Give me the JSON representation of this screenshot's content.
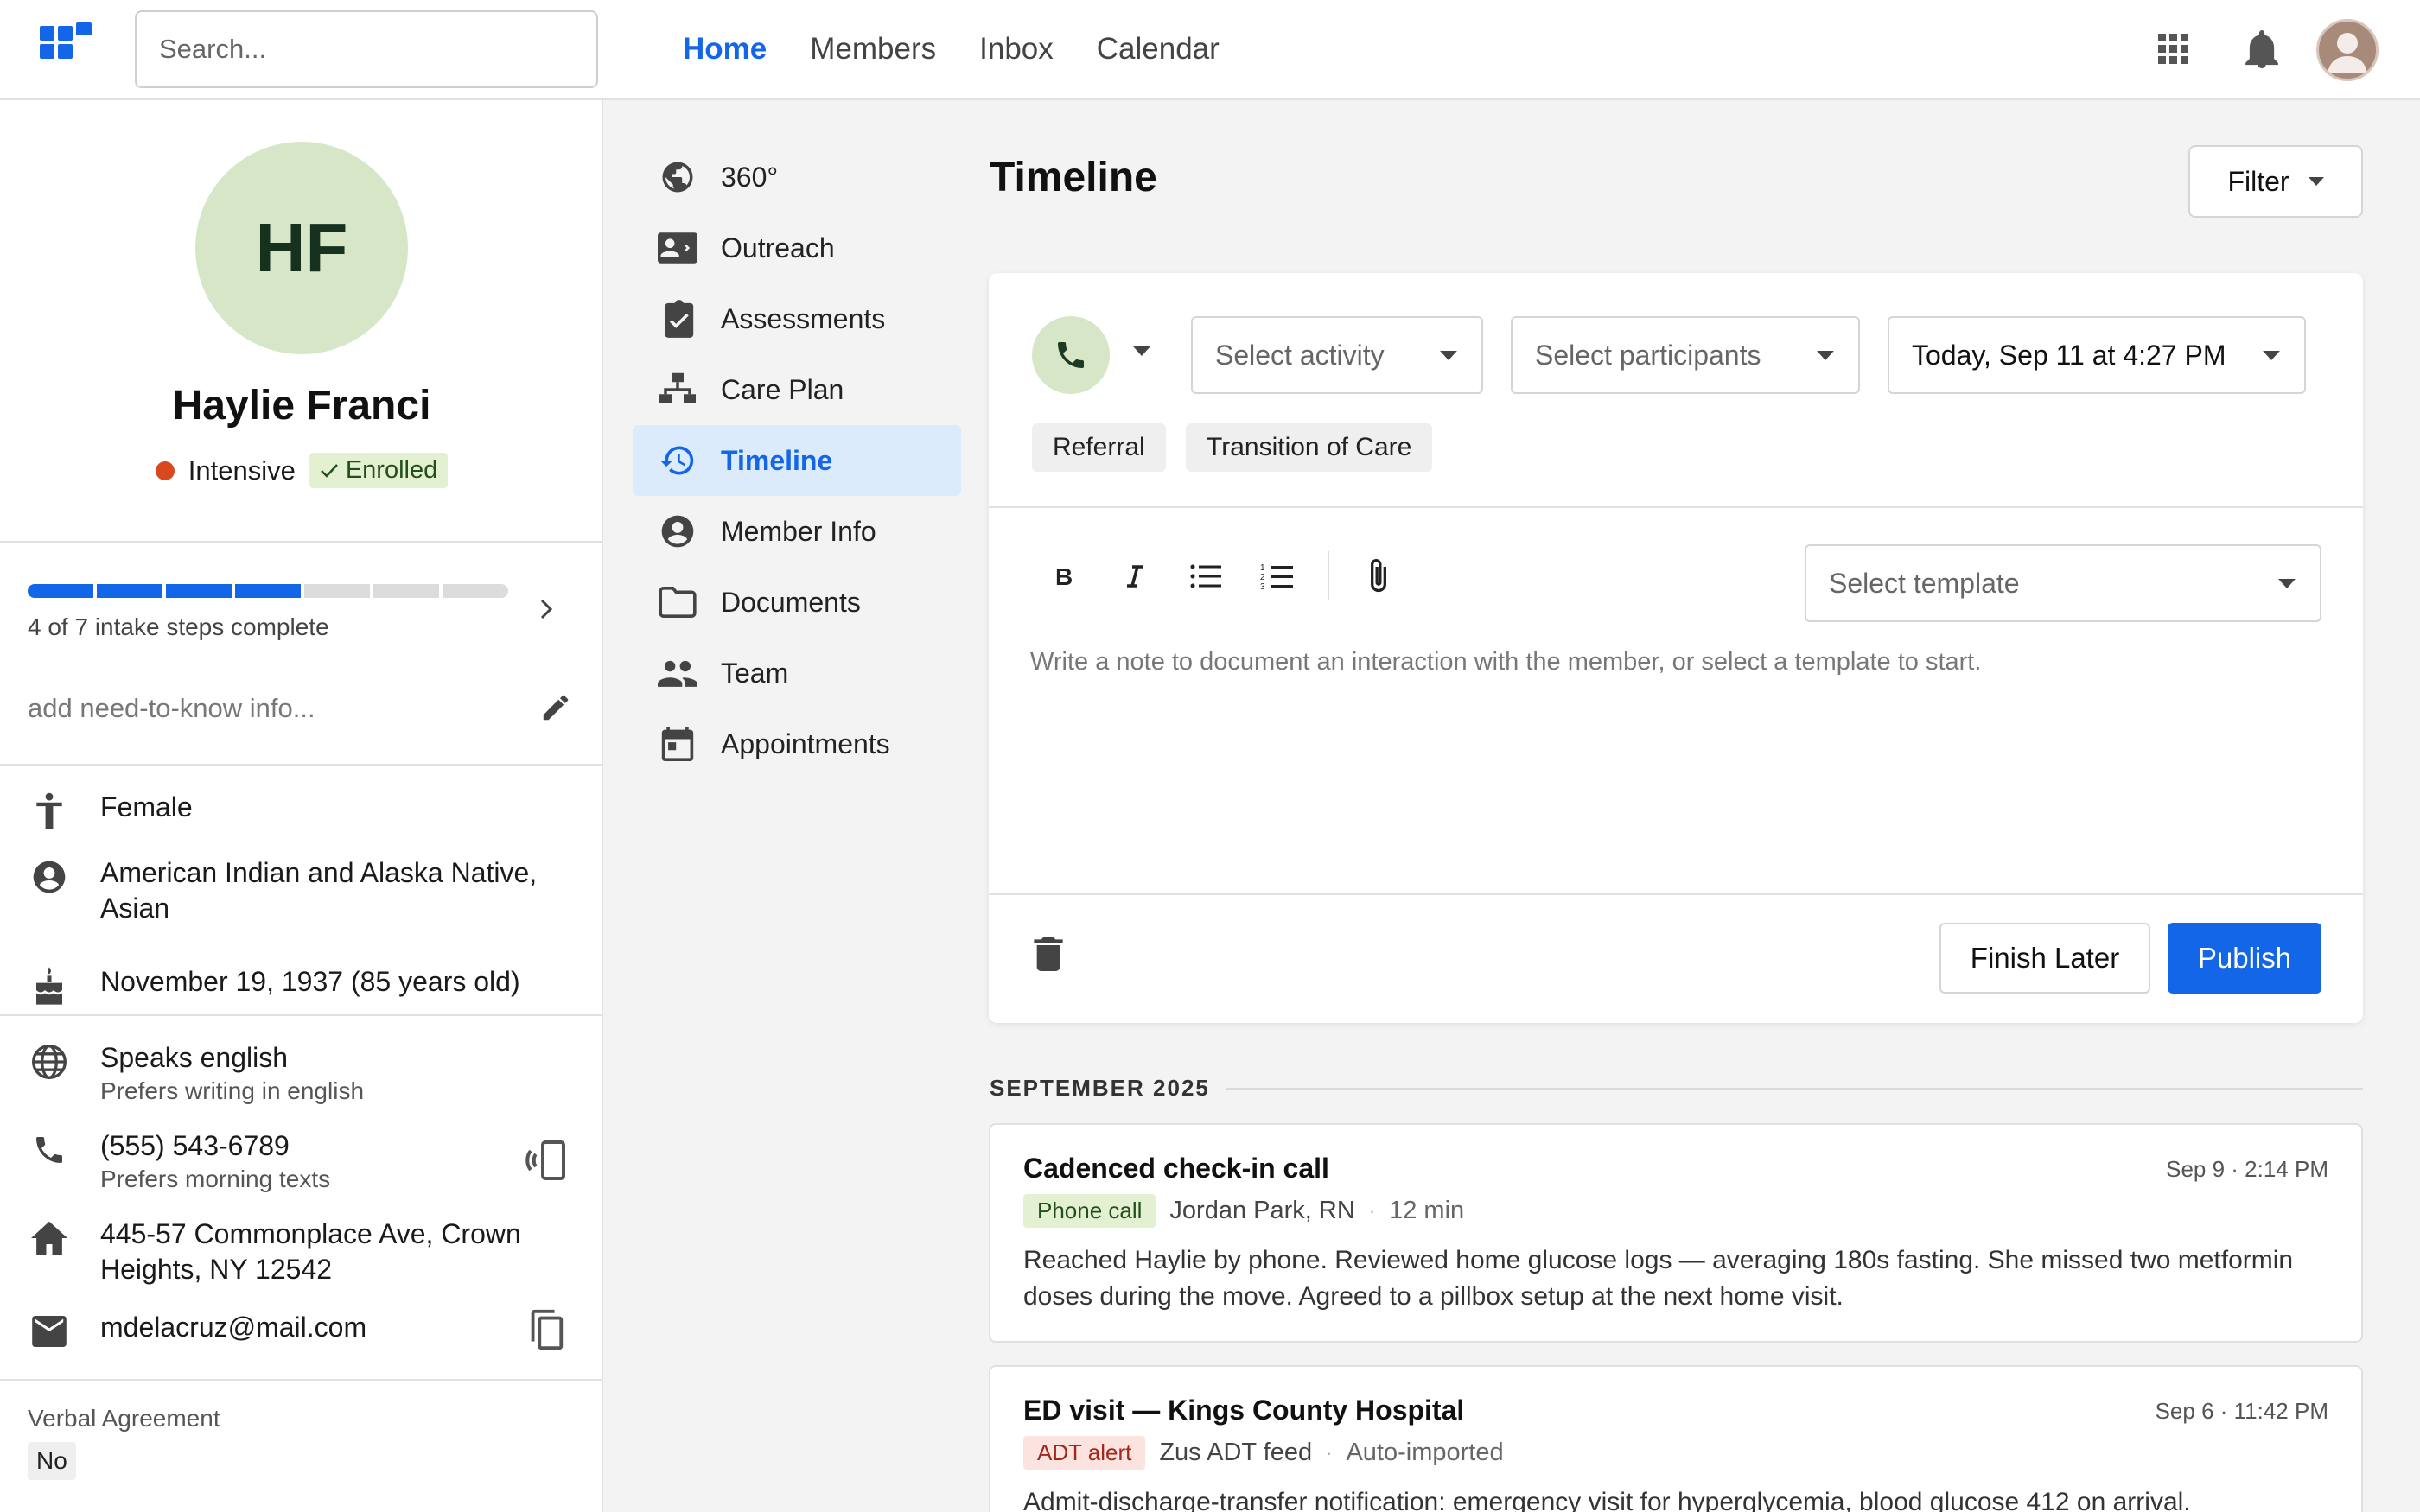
{
  "header": {
    "search_placeholder": "Search...",
    "nav": [
      "Home",
      "Members",
      "Inbox",
      "Calendar"
    ],
    "active_nav": "Home"
  },
  "member": {
    "initials": "HF",
    "name": "Haylie Franci",
    "acuity": "Intensive",
    "acuity_color": "#d9481f",
    "enrollment": "Enrolled",
    "intake_progress": {
      "completed": 4,
      "total": 7,
      "label": "4 of 7 intake steps complete"
    },
    "need_to_know_placeholder": "add need-to-know info...",
    "gender": "Female",
    "race_line1": "American Indian and Alaska Native,",
    "race_line2": "Asian",
    "dob": "November 19, 1937 (85 years old)",
    "language": "Speaks english",
    "language_sub": "Prefers writing in english",
    "phone": "(555) 543-6789",
    "phone_sub": "Prefers morning texts",
    "address_line1": "445-57 Commonplace Ave, Crown",
    "address_line2": "Heights, NY 12542",
    "email": "mdelacruz@mail.com",
    "verbal_agreement_label": "Verbal Agreement",
    "verbal_agreement_value": "No"
  },
  "subnav": {
    "items": [
      "360°",
      "Outreach",
      "Assessments",
      "Care Plan",
      "Timeline",
      "Member Info",
      "Documents",
      "Team",
      "Appointments"
    ],
    "active": "Timeline"
  },
  "timeline": {
    "title": "Timeline",
    "filter_label": "Filter",
    "composer": {
      "activity_placeholder": "Select activity",
      "participants_placeholder": "Select participants",
      "datetime": "Today, Sep 11 at 4:27 PM",
      "tags": [
        "Referral",
        "Transition of Care"
      ],
      "template_placeholder": "Select template",
      "note_placeholder": "Write a note to document an interaction with the member, or select a template to start.",
      "finish_later": "Finish Later",
      "publish": "Publish"
    },
    "month": "SEPTEMBER 2025",
    "entries": [
      {
        "title": "Cadenced check-in call",
        "time": "Sep 9 · 2:14 PM",
        "type": "Phone call",
        "author": "Jordan Park, RN",
        "extra": "12 min",
        "body": "Reached Haylie by phone. Reviewed home glucose logs — averaging 180s fasting. She missed two metformin doses during the move. Agreed to a pillbox setup at the next home visit."
      },
      {
        "title": "ED visit — Kings County Hospital",
        "time": "Sep 6 · 11:42 PM",
        "type": "ADT alert",
        "author": "Zus ADT feed",
        "extra": "Auto-imported",
        "body": "Admit-discharge-transfer notification: emergency visit for hyperglycemia, blood glucose 412 on arrival."
      }
    ]
  },
  "colors": {
    "accent": "#1466e8",
    "avatar_bg": "#d8e6c8",
    "alert_red": "#d9481f"
  }
}
